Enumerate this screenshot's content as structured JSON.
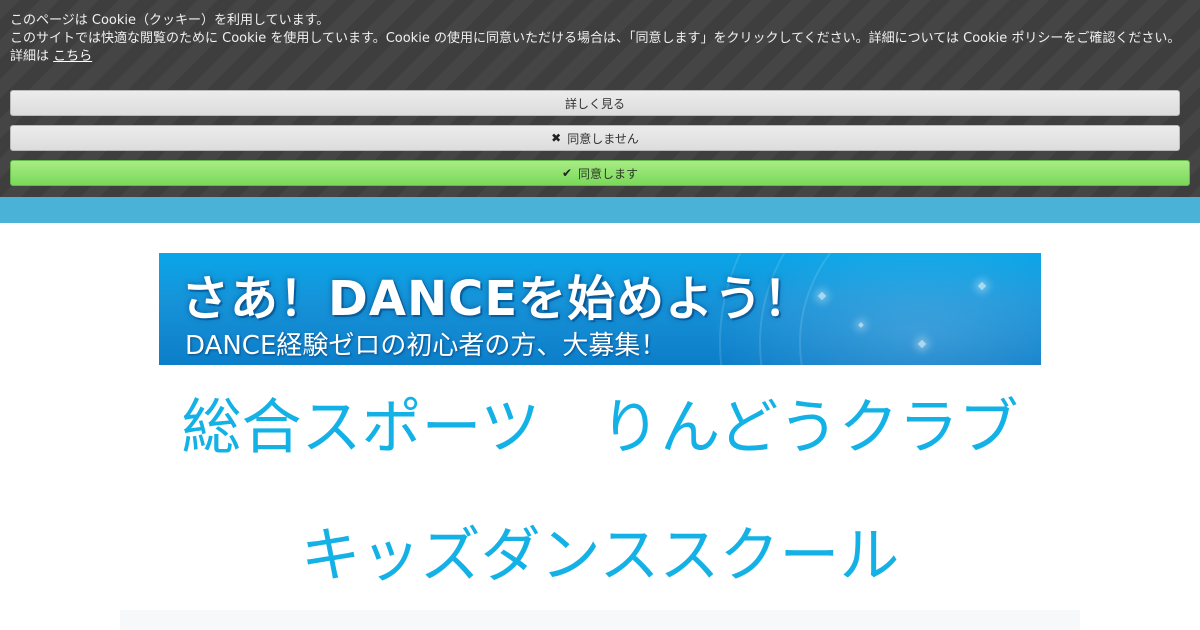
{
  "cookie_banner": {
    "line1": "このページは Cookie（クッキー）を利用しています。",
    "line2": "このサイトでは快適な閲覧のために Cookie を使用しています。Cookie の使用に同意いただける場合は、「同意します」をクリックしてください。詳細については Cookie ポリシーをご確認ください。",
    "details_prefix": "詳細は",
    "details_link": "こちら",
    "buttons": {
      "more": "詳しく見る",
      "decline": "同意しません",
      "accept": "同意します"
    },
    "icons": {
      "decline_icon": "close-icon",
      "accept_icon": "check-icon"
    }
  },
  "colors": {
    "banner_bg": "#3e3e3e",
    "nav_strip": "#4ab2d6",
    "accept_green": "#8ae067",
    "heading_blue": "#13b1e6"
  },
  "hero": {
    "title": "さあ！DANCEを始めよう！",
    "subtitle": "DANCE経験ゼロの初心者の方、大募集！"
  },
  "main": {
    "heading1": "総合スポーツ　りんどうクラブ",
    "heading2": "キッズダンススクール"
  }
}
